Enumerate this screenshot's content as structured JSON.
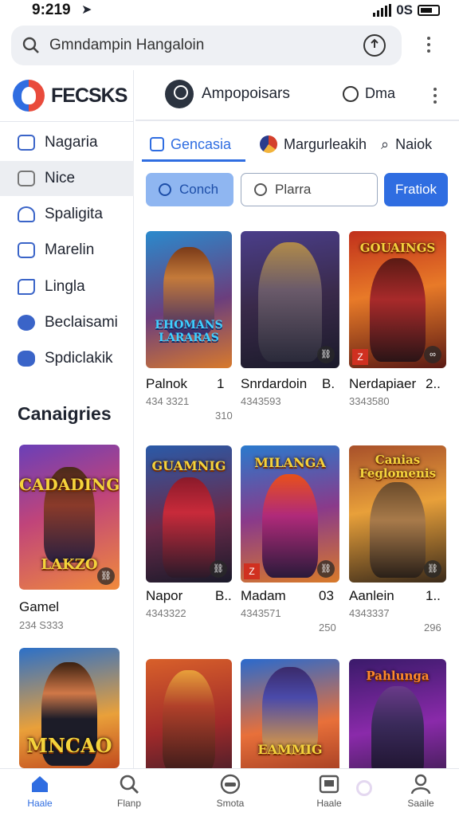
{
  "status": {
    "time": "9:219",
    "network": "0S"
  },
  "address_bar": {
    "text": "Gmndampin Hangaloin"
  },
  "brand": {
    "name": "FECSKS"
  },
  "header": {
    "user": "Ampopoisars",
    "game_label": "Dma"
  },
  "sidebar": {
    "items": [
      {
        "label": "Nagaria",
        "icon": "grid-icon",
        "active": false
      },
      {
        "label": "Nice",
        "icon": "box-icon",
        "active": true
      },
      {
        "label": "Spaligita",
        "icon": "person-icon",
        "active": false
      },
      {
        "label": "Marelin",
        "icon": "chart-icon",
        "active": false
      },
      {
        "label": "Lingla",
        "icon": "pencil-icon",
        "active": false
      },
      {
        "label": "Beclaisami",
        "icon": "users-icon",
        "active": false
      },
      {
        "label": "Spdiclakik",
        "icon": "puzzle-icon",
        "active": false
      }
    ],
    "categories_title": "Canaigries",
    "cards": [
      {
        "poster_title": "CADADING",
        "sub_title": "LAKZO",
        "name": "Gamel",
        "code": "234 S333"
      },
      {
        "poster_title": "MNCAO",
        "sub_title": "",
        "name": "",
        "code": ""
      }
    ]
  },
  "tabs": [
    {
      "label": "Gencasia",
      "active": true
    },
    {
      "label": "Margurleakih",
      "active": false
    },
    {
      "label": "Naiok",
      "active": false
    }
  ],
  "actions": {
    "search_btn": "Conch",
    "search_field": "Plarra",
    "filter_btn": "Fratiok"
  },
  "grid": [
    {
      "poster_title": "EHOMANS LARARAS",
      "name": "Palnok",
      "rank": "1",
      "code": "434 3321",
      "count": "310"
    },
    {
      "poster_title": "",
      "name": "Snrdardoin",
      "rank": "B.",
      "code": "4343593",
      "count": ""
    },
    {
      "poster_title": "GOUAINGS",
      "name": "Nerdapiaer",
      "rank": "2..",
      "code": "3343580",
      "count": ""
    },
    {
      "poster_title": "GUAMNIG",
      "name": "Napor",
      "rank": "B..",
      "code": "4343322",
      "count": ""
    },
    {
      "poster_title": "MILANGA",
      "name": "Madam",
      "rank": "03",
      "code": "4343571",
      "count": "250"
    },
    {
      "poster_title": "Canias Feglomenis",
      "name": "Aanlein",
      "rank": "1..",
      "code": "4343337",
      "count": "296"
    },
    {
      "poster_title": "",
      "name": "",
      "rank": "",
      "code": "",
      "count": ""
    },
    {
      "poster_title": "EAMMIG",
      "name": "",
      "rank": "",
      "code": "",
      "count": ""
    },
    {
      "poster_title": "Pahlunga",
      "name": "",
      "rank": "",
      "code": "",
      "count": ""
    }
  ],
  "bottom_nav": [
    {
      "label": "Haale",
      "icon": "home-icon",
      "active": true
    },
    {
      "label": "Flanp",
      "icon": "search-icon",
      "active": false
    },
    {
      "label": "Smota",
      "icon": "gamepad-icon",
      "active": false
    },
    {
      "label": "Haale",
      "icon": "photo-icon",
      "active": false
    },
    {
      "label": "Saaile",
      "icon": "profile-icon",
      "active": false
    }
  ],
  "colors": {
    "accent": "#2f6de1",
    "accent_light": "#8fb6f1",
    "text": "#1f2430"
  }
}
